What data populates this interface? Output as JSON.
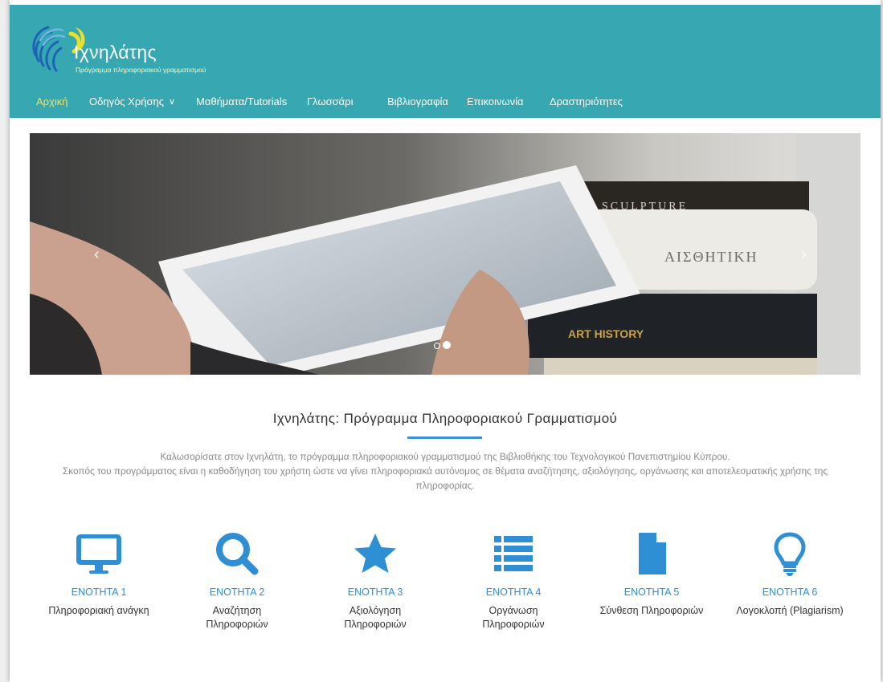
{
  "brand": {
    "title": "Ιχνηλάτης",
    "subtitle": "Πρόγραμμα πληροφοριακού γραμματισμού"
  },
  "nav": {
    "items": [
      {
        "label": "Αρχική",
        "active": true
      },
      {
        "label": "Οδηγός Χρήσης",
        "has_dropdown": true
      },
      {
        "label": "Μαθήματα/Tutorials"
      },
      {
        "label": "Γλωσσάρι"
      },
      {
        "label": "Βιβλιογραφία"
      },
      {
        "label": "Επικοινωνία"
      },
      {
        "label": "Δραστηριότητες"
      }
    ]
  },
  "slider": {
    "prev_icon": "chevron-left-icon",
    "next_icon": "chevron-right-icon",
    "prev_glyph": "‹",
    "next_glyph": "›",
    "slide_count": 2,
    "active_slide": 2,
    "book_spine_1": "SCULPTURE",
    "book_spine_2": "ΑΙΣΘΗΤΙΚΗ",
    "book_spine_3": "ART HISTORY"
  },
  "intro": {
    "title": "Ιχνηλάτης: Πρόγραμμα Πληροφοριακού Γραμματισμού",
    "line1": "Καλωσορίσατε στον Ιχνηλάτη, το πρόγραμμα πληροφοριακού γραμματισμού της Βιβλιοθήκης του Τεχνολογικού Πανεπιστημίου Κύπρου.",
    "line2": "Σκοπός του προγράμματος είναι η καθοδήγηση του χρήστη ώστε να γίνει πληροφοριακά αυτόνομος σε θέματα αναζήτησης, αξιολόγησης, οργάνωσης και αποτελεσματικής χρήσης της",
    "line3": "πληροφορίας."
  },
  "modules": [
    {
      "label": "ΕΝΟΤΗΤΑ 1",
      "line1": "Πληροφοριακή ανάγκη",
      "line2": "",
      "icon": "monitor-icon"
    },
    {
      "label": "ΕΝΟΤΗΤΑ 2",
      "line1": "Αναζήτηση",
      "line2": "Πληροφοριών",
      "icon": "search-icon"
    },
    {
      "label": "ΕΝΟΤΗΤΑ 3",
      "line1": "Αξιολόγηση",
      "line2": "Πληροφοριών",
      "icon": "star-icon"
    },
    {
      "label": "ΕΝΟΤΗΤΑ 4",
      "line1": "Οργάνωση",
      "line2": "Πληροφοριών",
      "icon": "list-icon"
    },
    {
      "label": "ΕΝΟΤΗΤΑ 5",
      "line1": "Σύνθεση Πληροφοριών",
      "line2": "",
      "icon": "document-icon"
    },
    {
      "label": "ΕΝΟΤΗΤΑ 6",
      "line1": "Λογοκλοπή (Plagiarism)",
      "line2": "",
      "icon": "lightbulb-icon"
    }
  ],
  "colors": {
    "header_bg": "#37a8b1",
    "nav_active": "#e7e36d",
    "accent_blue": "#2f8fd4",
    "icon_blue": "#2f8fd4"
  }
}
